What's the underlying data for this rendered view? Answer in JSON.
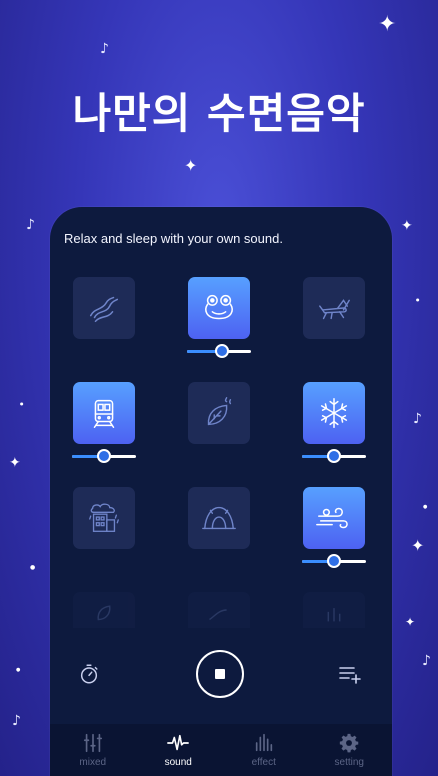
{
  "headline": "나만의 수면음악",
  "subtitle": "Relax and sleep with your own sound.",
  "sounds": [
    {
      "icon": "river-icon",
      "active": false
    },
    {
      "icon": "frog-icon",
      "active": true,
      "volume": 0.55
    },
    {
      "icon": "cricket-icon",
      "active": false
    },
    {
      "icon": "train-icon",
      "active": true,
      "volume": 0.5
    },
    {
      "icon": "leaf-water-icon",
      "active": false
    },
    {
      "icon": "snowflake-icon",
      "active": true,
      "volume": 0.5
    },
    {
      "icon": "rain-building-icon",
      "active": false
    },
    {
      "icon": "cave-icon",
      "active": false
    },
    {
      "icon": "wind-icon",
      "active": true,
      "volume": 0.5
    }
  ],
  "controls": {
    "timer_icon": "stopwatch-icon",
    "stop_icon": "stop-icon",
    "playlist_icon": "playlist-add-icon"
  },
  "nav": [
    {
      "label": "mixed",
      "icon": "mixer-icon",
      "active": false
    },
    {
      "label": "sound",
      "icon": "waveform-icon",
      "active": true
    },
    {
      "label": "effect",
      "icon": "equalizer-icon",
      "active": false
    },
    {
      "label": "setting",
      "icon": "gear-icon",
      "active": false
    }
  ],
  "colors": {
    "accent": "#4d62f2",
    "nav_active": "#ffffff",
    "nav_inactive": "#5c6586"
  }
}
